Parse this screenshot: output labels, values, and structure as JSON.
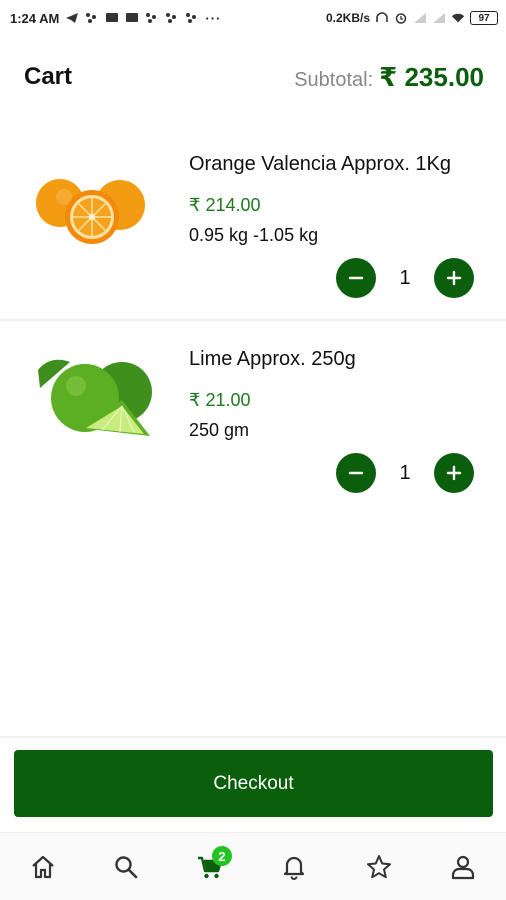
{
  "status_bar": {
    "time": "1:24 AM",
    "dots": "···",
    "speed": "0.2KB/s",
    "battery": "97"
  },
  "header": {
    "title": "Cart",
    "subtotal_label": "Subtotal:",
    "subtotal_value": "₹ 235.00"
  },
  "cart": {
    "items": [
      {
        "name": "Orange Valencia Approx. 1Kg",
        "price": "₹ 214.00",
        "weight": "0.95 kg -1.05 kg",
        "quantity": "1"
      },
      {
        "name": "Lime Approx. 250g",
        "price": "₹ 21.00",
        "weight": "250 gm",
        "quantity": "1"
      }
    ]
  },
  "checkout": {
    "label": "Checkout"
  },
  "bottom_nav": {
    "items": [
      {
        "icon": "home-icon"
      },
      {
        "icon": "search-icon"
      },
      {
        "icon": "cart-icon",
        "badge": "2",
        "active": true
      },
      {
        "icon": "bell-icon"
      },
      {
        "icon": "star-icon"
      },
      {
        "icon": "profile-icon"
      }
    ]
  },
  "colors": {
    "brand": "#0b5e0b",
    "price": "#1f7a1f",
    "badge": "#22c322",
    "muted": "#888888"
  }
}
